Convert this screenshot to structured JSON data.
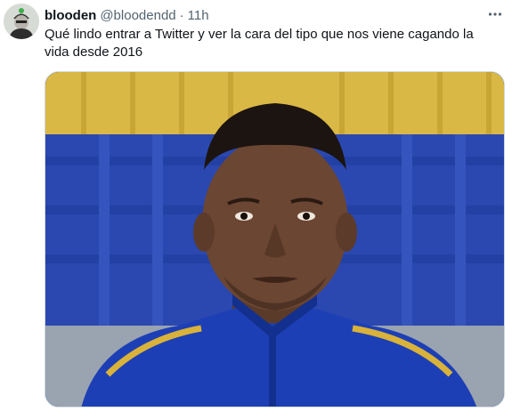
{
  "tweet": {
    "display_name": "blooden",
    "handle": "@bloodendd",
    "separator": "·",
    "time": "11h",
    "text": "Qué lindo entrar a Twitter y ver la cara del tipo que nos viene cagando la vida desde 2016",
    "avatar_icon": "user-avatar",
    "more_icon": "more-horizontal-icon",
    "media_description_icon": "photo"
  },
  "colors": {
    "text_primary": "#0f1419",
    "text_secondary": "#536471",
    "border": "#cfd9de",
    "jersey_blue": "#1d3fb5",
    "jersey_gold": "#d8b23a"
  }
}
